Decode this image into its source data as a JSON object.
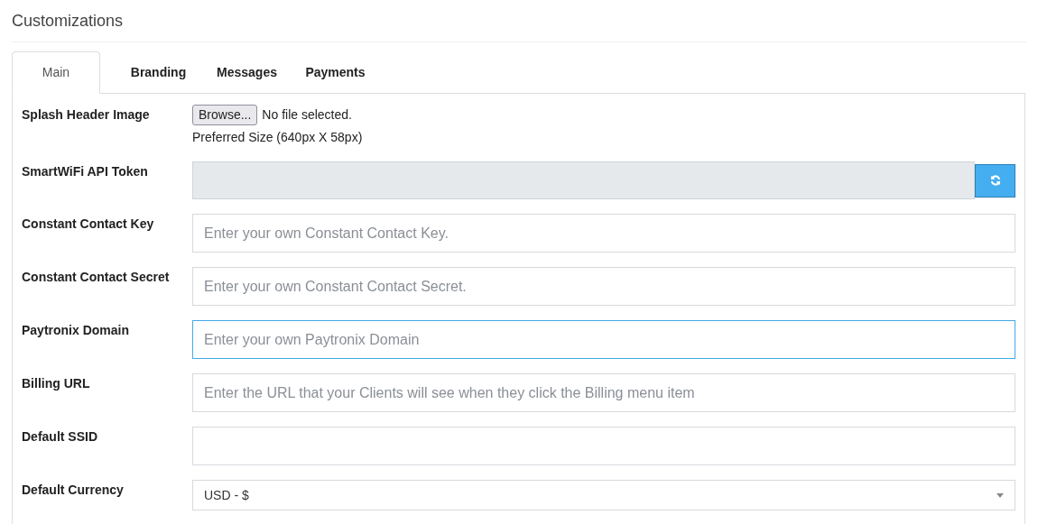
{
  "page_title": "Customizations",
  "tabs": [
    {
      "label": "Main",
      "selected": true
    },
    {
      "label": "Branding",
      "selected": false
    },
    {
      "label": "Messages",
      "selected": false
    },
    {
      "label": "Payments",
      "selected": false
    }
  ],
  "fields": [
    {
      "kind": "file",
      "label": "Splash Header Image",
      "button": "Browse...",
      "value": "No file selected.",
      "hint": "Preferred Size (640px X 58px)"
    },
    {
      "kind": "token",
      "label": "SmartWiFi API Token",
      "disabled": true
    },
    {
      "kind": "text",
      "label": "Constant Contact Key",
      "placeholder": "Enter your own Constant Contact Key.",
      "focused": false
    },
    {
      "kind": "text",
      "label": "Constant Contact Secret",
      "placeholder": "Enter your own Constant Contact Secret.",
      "focused": false
    },
    {
      "kind": "text",
      "label": "Paytronix Domain",
      "placeholder": "Enter your own Paytronix Domain",
      "focused": true
    },
    {
      "kind": "text",
      "label": "Billing URL",
      "placeholder": "Enter the URL that your Clients will see when they click the Billing menu item",
      "focused": false
    },
    {
      "kind": "text",
      "label": "Default SSID",
      "focused": false
    },
    {
      "kind": "select",
      "label": "Default Currency",
      "value": "USD - $"
    }
  ]
}
